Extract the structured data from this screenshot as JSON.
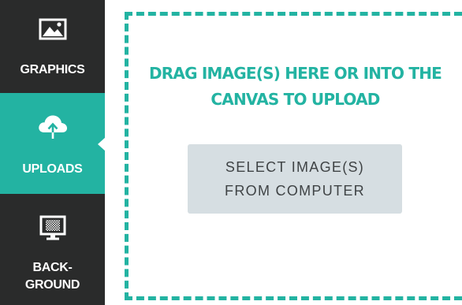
{
  "sidebar": {
    "items": [
      {
        "label": "GRAPHICS",
        "icon": "image-icon",
        "active": false
      },
      {
        "label": "UPLOADS",
        "icon": "cloud-upload-icon",
        "active": true
      },
      {
        "label": "BACK-\nGROUND",
        "icon": "monitor-icon",
        "active": false
      }
    ]
  },
  "upload": {
    "heading": "DRAG IMAGE(S) HERE OR INTO THE CANVAS TO UPLOAD",
    "select_button": "SELECT IMAGE(S)\nFROM COMPUTER"
  },
  "colors": {
    "accent": "#23b3a2",
    "sidebar_bg": "#2a2b2b",
    "button_bg": "#d6dee2",
    "button_text": "#3f4345"
  }
}
